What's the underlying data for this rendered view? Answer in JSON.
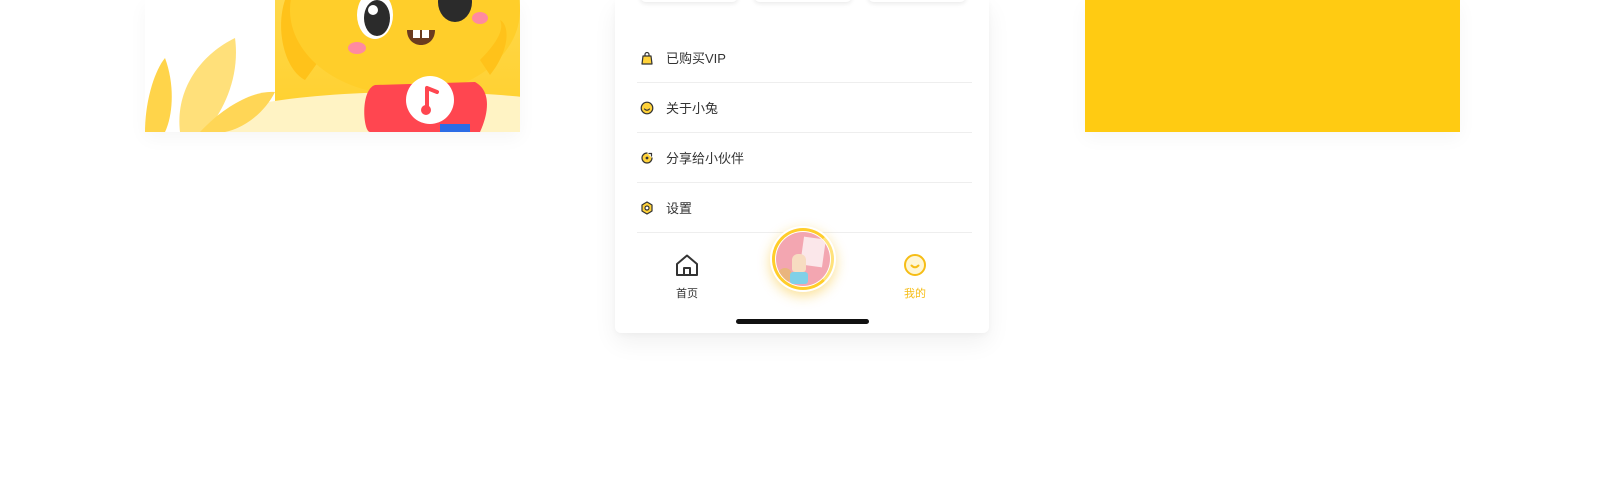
{
  "menu": {
    "items": [
      {
        "label": "已购买VIP",
        "icon": "shopping-bag-icon"
      },
      {
        "label": "关于小兔",
        "icon": "smile-face-icon"
      },
      {
        "label": "分享给小伙伴",
        "icon": "share-icon"
      },
      {
        "label": "设置",
        "icon": "gear-icon"
      }
    ]
  },
  "tabbar": {
    "home_label": "首页",
    "mine_label": "我的",
    "active_tab": "mine"
  },
  "colors": {
    "accent": "#f6bd16",
    "brand_yellow": "#ffcb12",
    "text": "#333333",
    "divider": "#eeeeee"
  }
}
